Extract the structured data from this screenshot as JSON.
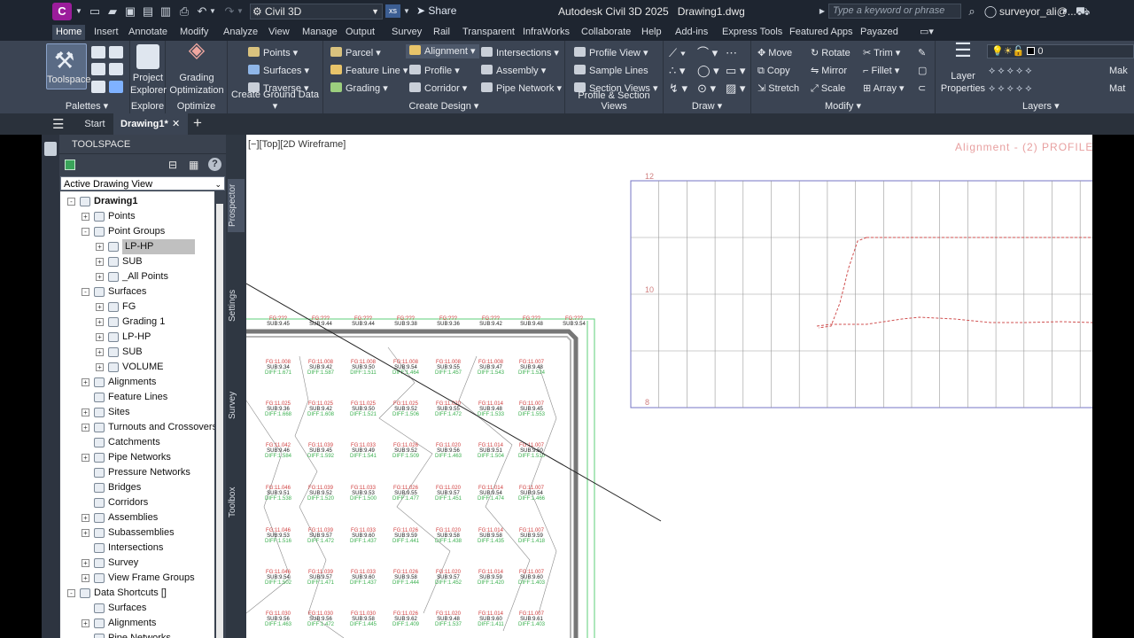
{
  "titlebar": {
    "app_letter": "C",
    "workspace": "Civil 3D",
    "xs": "xs",
    "share": "Share",
    "title": "Autodesk Civil 3D 2025",
    "document": "Drawing1.dwg",
    "search_placeholder": "Type a keyword or phrase",
    "user": "surveyor_ali@..."
  },
  "menu_tabs": [
    "Home",
    "Insert",
    "Annotate",
    "Modify",
    "Analyze",
    "View",
    "Manage",
    "Output",
    "Survey",
    "Rail",
    "Transparent",
    "InfraWorks",
    "Collaborate",
    "Help",
    "Add-ins",
    "Express Tools",
    "Featured Apps",
    "Payazed"
  ],
  "ribbon": {
    "palettes": {
      "toolspace": "Toolspace",
      "title": "Palettes"
    },
    "explore": {
      "project_explorer": "Project Explorer",
      "title": "Explore"
    },
    "optimize": {
      "grading_opt": "Grading Optimization",
      "title": "Optimize"
    },
    "ground": {
      "points": "Points",
      "surfaces": "Surfaces",
      "traverse": "Traverse",
      "title": "Create Ground Data"
    },
    "design": {
      "parcel": "Parcel",
      "feature_line": "Feature Line",
      "grading": "Grading",
      "alignment": "Alignment",
      "profile": "Profile",
      "corridor": "Corridor",
      "intersections": "Intersections",
      "assembly": "Assembly",
      "pipe_network": "Pipe Network",
      "title": "Create Design"
    },
    "profile_section": {
      "profile_view": "Profile View",
      "sample_lines": "Sample Lines",
      "section_views": "Section Views",
      "title": "Profile & Section Views"
    },
    "draw": {
      "title": "Draw"
    },
    "modify": {
      "move": "Move",
      "rotate": "Rotate",
      "trim": "Trim",
      "copy": "Copy",
      "mirror": "Mirror",
      "fillet": "Fillet",
      "stretch": "Stretch",
      "scale": "Scale",
      "array": "Array",
      "title": "Modify"
    },
    "layers": {
      "layer_properties": "Layer Properties",
      "layer_value": "0",
      "make": "Mak",
      "match": "Mat",
      "title": "Layers"
    }
  },
  "doc_tabs": {
    "start": "Start",
    "drawing": "Drawing1*"
  },
  "toolspace": {
    "title": "TOOLSPACE",
    "view_select": "Active Drawing View",
    "tree": [
      {
        "label": "Drawing1",
        "level": 0,
        "exp": "-",
        "bold": true
      },
      {
        "label": "Points",
        "level": 1,
        "exp": "+"
      },
      {
        "label": "Point Groups",
        "level": 1,
        "exp": "-"
      },
      {
        "label": "LP-HP",
        "level": 2,
        "exp": "+",
        "selected": true
      },
      {
        "label": "SUB",
        "level": 2,
        "exp": "+"
      },
      {
        "label": "_All Points",
        "level": 2,
        "exp": "+"
      },
      {
        "label": "Surfaces",
        "level": 1,
        "exp": "-"
      },
      {
        "label": "FG",
        "level": 2,
        "exp": "+"
      },
      {
        "label": "Grading 1",
        "level": 2,
        "exp": "+"
      },
      {
        "label": "LP-HP",
        "level": 2,
        "exp": "+"
      },
      {
        "label": "SUB",
        "level": 2,
        "exp": "+"
      },
      {
        "label": "VOLUME",
        "level": 2,
        "exp": "+"
      },
      {
        "label": "Alignments",
        "level": 1,
        "exp": "+"
      },
      {
        "label": "Feature Lines",
        "level": 1,
        "exp": ""
      },
      {
        "label": "Sites",
        "level": 1,
        "exp": "+"
      },
      {
        "label": "Turnouts and Crossovers",
        "level": 1,
        "exp": "+"
      },
      {
        "label": "Catchments",
        "level": 1,
        "exp": ""
      },
      {
        "label": "Pipe Networks",
        "level": 1,
        "exp": "+"
      },
      {
        "label": "Pressure Networks",
        "level": 1,
        "exp": ""
      },
      {
        "label": "Bridges",
        "level": 1,
        "exp": ""
      },
      {
        "label": "Corridors",
        "level": 1,
        "exp": ""
      },
      {
        "label": "Assemblies",
        "level": 1,
        "exp": "+"
      },
      {
        "label": "Subassemblies",
        "level": 1,
        "exp": "+"
      },
      {
        "label": "Intersections",
        "level": 1,
        "exp": ""
      },
      {
        "label": "Survey",
        "level": 1,
        "exp": "+"
      },
      {
        "label": "View Frame Groups",
        "level": 1,
        "exp": "+"
      },
      {
        "label": "Data Shortcuts []",
        "level": 0,
        "exp": "-"
      },
      {
        "label": "Surfaces",
        "level": 1,
        "exp": ""
      },
      {
        "label": "Alignments",
        "level": 1,
        "exp": "+"
      },
      {
        "label": "Pipe Networks",
        "level": 1,
        "exp": ""
      }
    ]
  },
  "side_tabs": [
    "Prospector",
    "Settings",
    "Survey",
    "Toolbox"
  ],
  "drawing": {
    "view_label": "[−][Top][2D Wireframe]",
    "profile_title": "Alignment - (2) PROFILE",
    "profile_y_labels": [
      "12",
      "10",
      "8"
    ],
    "top_row": [
      [
        "FG:???",
        "SUB:9.45"
      ],
      [
        "FG:???",
        "SUB:9.44"
      ],
      [
        "FG:???",
        "SUB:9.44"
      ],
      [
        "FG:???",
        "SUB:9.38"
      ],
      [
        "FG:???",
        "SUB:9.36"
      ],
      [
        "FG:???",
        "SUB:9.42"
      ],
      [
        "FG:???",
        "SUB:9.48"
      ],
      [
        "FG:???",
        "SUB:9.54"
      ]
    ],
    "grid_rows": [
      [
        [
          "FG:11.008",
          "SUB:9.34",
          "DIFF:1.671"
        ],
        [
          "FG:11.008",
          "SUB:9.42",
          "DIFF:1.587"
        ],
        [
          "FG:11.008",
          "SUB:9.50",
          "DIFF:1.511"
        ],
        [
          "FG:11.008",
          "SUB:9.54",
          "DIFF:1.464"
        ],
        [
          "FG:11.008",
          "SUB:9.55",
          "DIFF:1.457"
        ],
        [
          "FG:11.008",
          "SUB:9.47",
          "DIFF:1.543"
        ],
        [
          "FG:11.007",
          "SUB:9.48",
          "DIFF:1.524"
        ]
      ],
      [
        [
          "FG:11.025",
          "SUB:9.36",
          "DIFF:1.668"
        ],
        [
          "FG:11.025",
          "SUB:9.42",
          "DIFF:1.608"
        ],
        [
          "FG:11.025",
          "SUB:9.50",
          "DIFF:1.521"
        ],
        [
          "FG:11.025",
          "SUB:9.52",
          "DIFF:1.506"
        ],
        [
          "FG:11.020",
          "SUB:9.55",
          "DIFF:1.472"
        ],
        [
          "FG:11.014",
          "SUB:9.48",
          "DIFF:1.533"
        ],
        [
          "FG:11.007",
          "SUB:9.45",
          "DIFF:1.553"
        ]
      ],
      [
        [
          "FG:11.042",
          "SUB:9.46",
          "DIFF:1.584"
        ],
        [
          "FG:11.039",
          "SUB:9.45",
          "DIFF:1.592"
        ],
        [
          "FG:11.033",
          "SUB:9.49",
          "DIFF:1.541"
        ],
        [
          "FG:11.026",
          "SUB:9.52",
          "DIFF:1.509"
        ],
        [
          "FG:11.020",
          "SUB:9.56",
          "DIFF:1.463"
        ],
        [
          "FG:11.014",
          "SUB:9.51",
          "DIFF:1.504"
        ],
        [
          "FG:11.007",
          "SUB:9.50",
          "DIFF:1.510"
        ]
      ],
      [
        [
          "FG:11.046",
          "SUB:9.51",
          "DIFF:1.538"
        ],
        [
          "FG:11.039",
          "SUB:9.52",
          "DIFF:1.520"
        ],
        [
          "FG:11.033",
          "SUB:9.53",
          "DIFF:1.500"
        ],
        [
          "FG:11.026",
          "SUB:9.55",
          "DIFF:1.477"
        ],
        [
          "FG:11.020",
          "SUB:9.57",
          "DIFF:1.451"
        ],
        [
          "FG:11.014",
          "SUB:9.54",
          "DIFF:1.474"
        ],
        [
          "FG:11.007",
          "SUB:9.54",
          "DIFF:1.466"
        ]
      ],
      [
        [
          "FG:11.046",
          "SUB:9.53",
          "DIFF:1.516"
        ],
        [
          "FG:11.039",
          "SUB:9.57",
          "DIFF:1.472"
        ],
        [
          "FG:11.033",
          "SUB:9.60",
          "DIFF:1.437"
        ],
        [
          "FG:11.026",
          "SUB:9.59",
          "DIFF:1.441"
        ],
        [
          "FG:11.020",
          "SUB:9.58",
          "DIFF:1.438"
        ],
        [
          "FG:11.014",
          "SUB:9.58",
          "DIFF:1.435"
        ],
        [
          "FG:11.007",
          "SUB:9.59",
          "DIFF:1.418"
        ]
      ],
      [
        [
          "FG:11.046",
          "SUB:9.54",
          "DIFF:1.502"
        ],
        [
          "FG:11.039",
          "SUB:9.57",
          "DIFF:1.471"
        ],
        [
          "FG:11.033",
          "SUB:9.60",
          "DIFF:1.437"
        ],
        [
          "FG:11.026",
          "SUB:9.58",
          "DIFF:1.444"
        ],
        [
          "FG:11.020",
          "SUB:9.57",
          "DIFF:1.452"
        ],
        [
          "FG:11.014",
          "SUB:9.59",
          "DIFF:1.420"
        ],
        [
          "FG:11.007",
          "SUB:9.60",
          "DIFF:1.403"
        ]
      ],
      [
        [
          "FG:11.030",
          "SUB:9.56",
          "DIFF:1.463"
        ],
        [
          "FG:11.030",
          "SUB:9.56",
          "DIFF:1.472"
        ],
        [
          "FG:11.030",
          "SUB:9.58",
          "DIFF:1.445"
        ],
        [
          "FG:11.026",
          "SUB:9.62",
          "DIFF:1.409"
        ],
        [
          "FG:11.020",
          "SUB:9.48",
          "DIFF:1.537"
        ],
        [
          "FG:11.014",
          "SUB:9.60",
          "DIFF:1.411"
        ],
        [
          "FG:11.007",
          "SUB:9.61",
          "DIFF:1.403"
        ]
      ]
    ]
  }
}
